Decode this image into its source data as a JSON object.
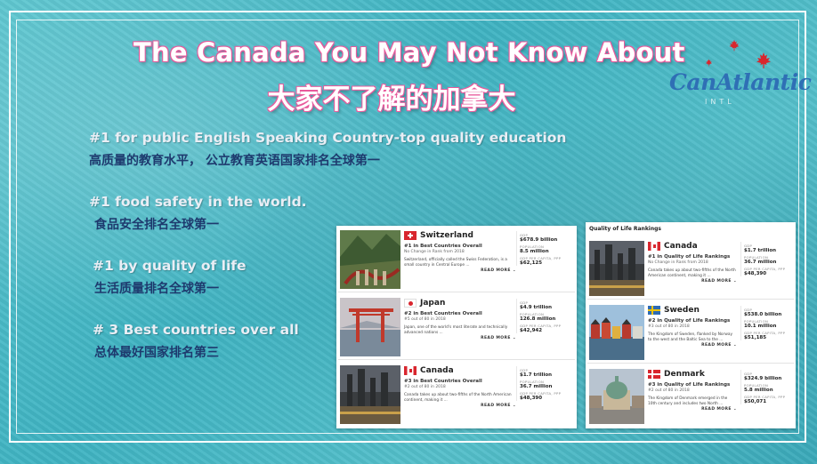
{
  "title": {
    "english": "The Canada You May Not Know About",
    "chinese": "大家不了解的加拿大"
  },
  "logo": {
    "text": "CanAtlantic",
    "subtext": "INTL"
  },
  "facts": [
    {
      "en": "#1 for public English Speaking Country-top quality   education",
      "zh": "高质量的教育水平， 公立教育英语国家排名全球第一"
    },
    {
      "en": "#1 food safety  in the world.",
      "zh": "食品安全排名全球第一"
    },
    {
      "en": "#1 by quality of life",
      "zh": "生活质量排名全球第一"
    },
    {
      "en": "# 3 Best countries over all",
      "zh": "总体最好国家排名第三"
    }
  ],
  "labels": {
    "gdp": "GDP",
    "population": "POPULATION",
    "gdp_per_capita": "GDP PER CAPITA, PPP",
    "read_more": "READ MORE ⌄"
  },
  "best_countries": [
    {
      "name": "Switzerland",
      "rank": "#1 in Best Countries Overall",
      "rank_sub": "No Change in Rank from 2018",
      "desc": "Switzerland, officially called the Swiss Federation, is a small country in Central Europe ...",
      "gdp": "$678.9 billion",
      "population": "8.5 million",
      "gdp_pc": "$62,125"
    },
    {
      "name": "Japan",
      "rank": "#2 in Best Countries Overall",
      "rank_sub": "#5 out of 80 in 2018",
      "desc": "Japan, one of the world's most literate and technically advanced nations ...",
      "gdp": "$4.9 trillion",
      "population": "126.8 million",
      "gdp_pc": "$42,942"
    },
    {
      "name": "Canada",
      "rank": "#3 in Best Countries Overall",
      "rank_sub": "#2 out of 80 in 2018",
      "desc": "Canada takes up about two-fifths of the North American continent, making it ...",
      "gdp": "$1.7 trillion",
      "population": "36.7 million",
      "gdp_pc": "$48,390"
    }
  ],
  "quality_of_life": {
    "title": "Quality of Life Rankings",
    "items": [
      {
        "name": "Canada",
        "rank": "#1 in Quality of Life Rankings",
        "rank_sub": "No Change in Rank from 2018",
        "desc": "Canada takes up about two-fifths of the North American continent, making it ...",
        "gdp": "$1.7 trillion",
        "population": "36.7 million",
        "gdp_pc": "$48,390"
      },
      {
        "name": "Sweden",
        "rank": "#2 in Quality of Life Rankings",
        "rank_sub": "#3 out of 80 in 2018",
        "desc": "The Kingdom of Sweden, flanked by Norway to the west and the Baltic Sea to the ...",
        "gdp": "$538.0 billion",
        "population": "10.1 million",
        "gdp_pc": "$51,185"
      },
      {
        "name": "Denmark",
        "rank": "#3 in Quality of Life Rankings",
        "rank_sub": "#2 out of 80 in 2018",
        "desc": "The Kingdom of Denmark emerged in the 10th century and includes two North ...",
        "gdp": "$324.9 billion",
        "population": "5.8 million",
        "gdp_pc": "$50,071"
      }
    ]
  },
  "colors": {
    "title_outline": "#e85a9c",
    "chinese_fact": "#1e3a6e",
    "english_fact": "#e9eef5",
    "logo": "#2f6fb5",
    "maple_leaf": "#d8262e"
  }
}
